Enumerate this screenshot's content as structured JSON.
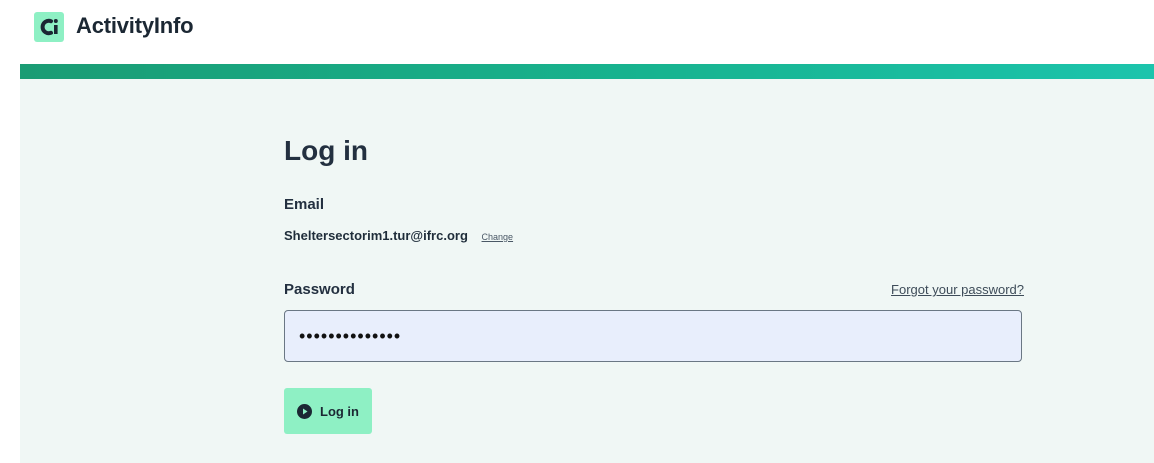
{
  "header": {
    "brand": "ActivityInfo",
    "logo_icon": "activityinfo-logo-icon"
  },
  "login": {
    "title": "Log in",
    "email_label": "Email",
    "email_value": "Sheltersectorim1.tur@ifrc.org",
    "change_link": "Change",
    "password_label": "Password",
    "forgot_link": "Forgot your password?",
    "password_value": "••••••••••••••",
    "submit_label": "Log in",
    "submit_icon": "play-circle-icon"
  },
  "colors": {
    "accent": "#8ef0c4",
    "stripe_start": "#1a9c74",
    "stripe_end": "#1cc4ac",
    "panel_bg": "#f0f7f5",
    "input_bg": "#e8eefc"
  }
}
